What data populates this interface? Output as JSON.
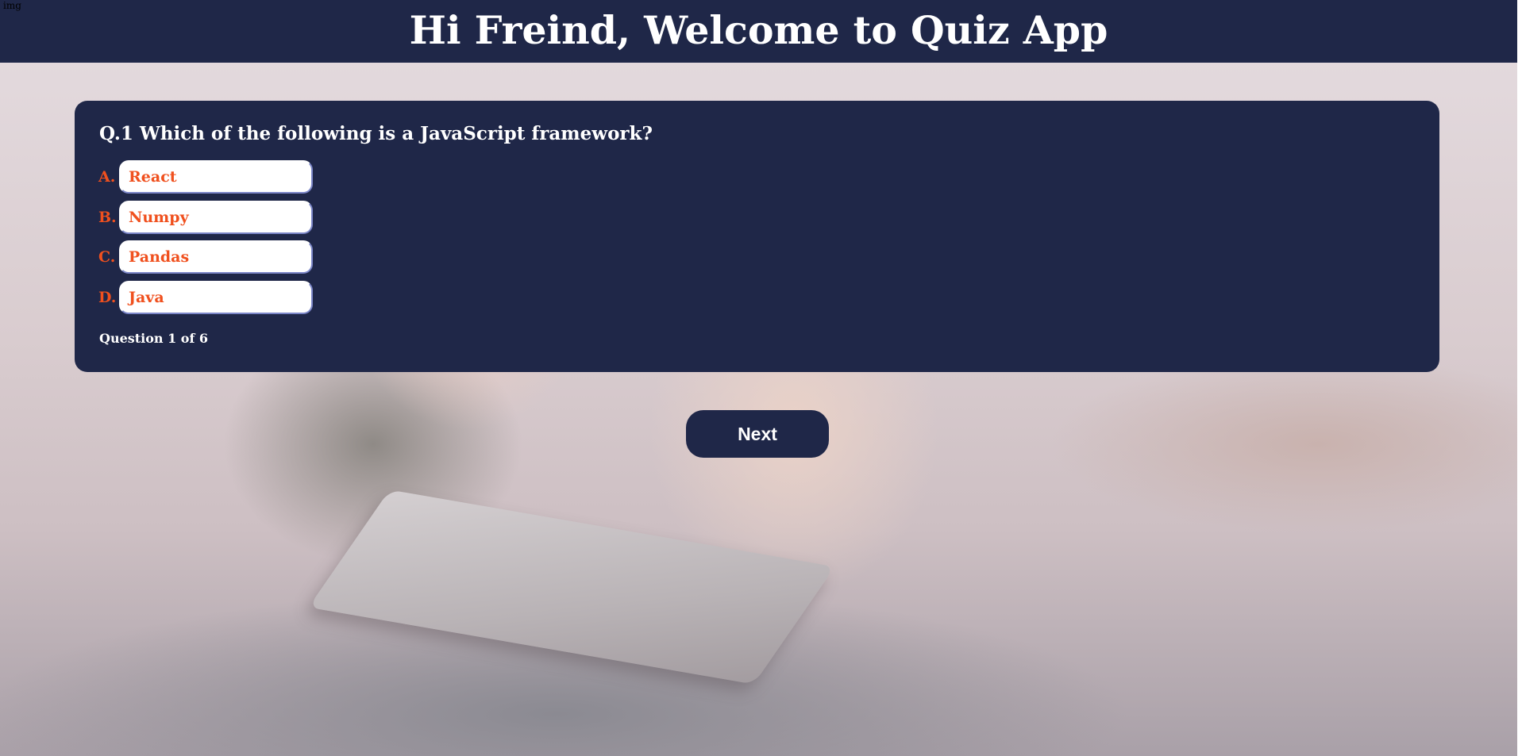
{
  "header": {
    "title": "Hi Freind, Welcome to Quiz App"
  },
  "broken_image": {
    "alt": "img"
  },
  "quiz": {
    "question": "Q.1 Which of the following is a JavaScript framework?",
    "options": [
      {
        "letter": "A.",
        "text": "React"
      },
      {
        "letter": "B.",
        "text": "Numpy"
      },
      {
        "letter": "C.",
        "text": "Pandas"
      },
      {
        "letter": "D.",
        "text": "Java"
      }
    ],
    "counter": "Question 1 of 6"
  },
  "controls": {
    "next_label": "Next"
  },
  "colors": {
    "navy": "#1f2748",
    "accent": "#f0501e",
    "white": "#ffffff"
  },
  "background": {
    "description_icon": "kids-with-tablet-photo"
  }
}
